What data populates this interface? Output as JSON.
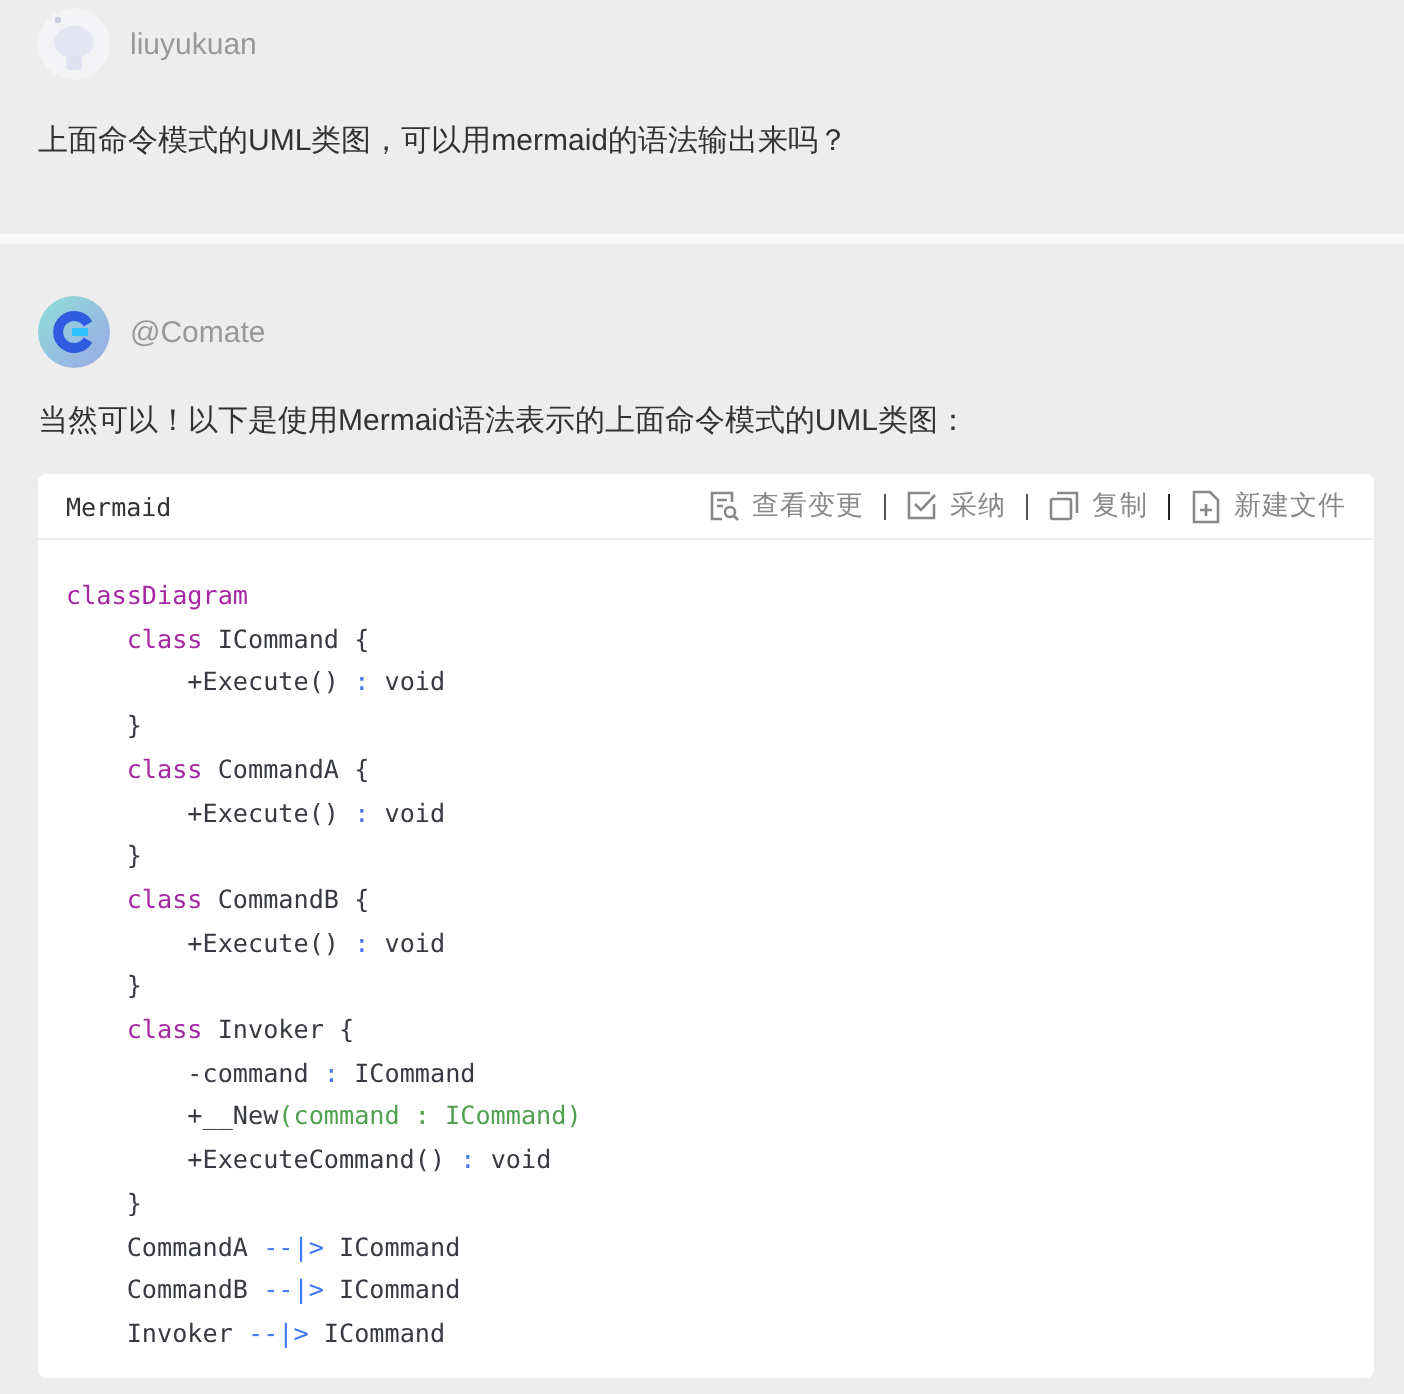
{
  "messages": [
    {
      "kind": "user",
      "author": "liuyukuan",
      "text": "上面命令模式的UML类图，可以用mermaid的语法输出来吗？"
    },
    {
      "kind": "bot",
      "author": "@Comate",
      "text": "当然可以！以下是使用Mermaid语法表示的上面命令模式的UML类图：",
      "code": {
        "language": "Mermaid",
        "actions": [
          {
            "kind": "diff",
            "label": "查看变更"
          },
          {
            "kind": "accept",
            "label": "采纳"
          },
          {
            "kind": "copy",
            "label": "复制"
          },
          {
            "kind": "newfile",
            "label": "新建文件"
          }
        ],
        "lines": [
          [
            {
              "kind": "keyword",
              "text": "classDiagram"
            }
          ],
          [
            {
              "kind": "keyword",
              "text": "    class"
            },
            {
              "kind": "plain",
              "text": " ICommand {"
            }
          ],
          [
            {
              "kind": "plain",
              "text": "        +Execute() "
            },
            {
              "kind": "operator",
              "text": ":"
            },
            {
              "kind": "plain",
              "text": " void"
            }
          ],
          [
            {
              "kind": "plain",
              "text": "    }"
            }
          ],
          [
            {
              "kind": "keyword",
              "text": "    class"
            },
            {
              "kind": "plain",
              "text": " CommandA {"
            }
          ],
          [
            {
              "kind": "plain",
              "text": "        +Execute() "
            },
            {
              "kind": "operator",
              "text": ":"
            },
            {
              "kind": "plain",
              "text": " void"
            }
          ],
          [
            {
              "kind": "plain",
              "text": "    }"
            }
          ],
          [
            {
              "kind": "keyword",
              "text": "    class"
            },
            {
              "kind": "plain",
              "text": " CommandB {"
            }
          ],
          [
            {
              "kind": "plain",
              "text": "        +Execute() "
            },
            {
              "kind": "operator",
              "text": ":"
            },
            {
              "kind": "plain",
              "text": " void"
            }
          ],
          [
            {
              "kind": "plain",
              "text": "    }"
            }
          ],
          [
            {
              "kind": "keyword",
              "text": "    class"
            },
            {
              "kind": "plain",
              "text": " Invoker {"
            }
          ],
          [
            {
              "kind": "plain",
              "text": "        -command "
            },
            {
              "kind": "operator",
              "text": ":"
            },
            {
              "kind": "plain",
              "text": " ICommand"
            }
          ],
          [
            {
              "kind": "plain",
              "text": "        +__New"
            },
            {
              "kind": "param",
              "text": "(command : ICommand)"
            }
          ],
          [
            {
              "kind": "plain",
              "text": "        +ExecuteCommand() "
            },
            {
              "kind": "operator",
              "text": ":"
            },
            {
              "kind": "plain",
              "text": " void"
            }
          ],
          [
            {
              "kind": "plain",
              "text": "    }"
            }
          ],
          [
            {
              "kind": "plain",
              "text": "    CommandA "
            },
            {
              "kind": "operator",
              "text": "--|>"
            },
            {
              "kind": "plain",
              "text": " ICommand"
            }
          ],
          [
            {
              "kind": "plain",
              "text": "    CommandB "
            },
            {
              "kind": "operator",
              "text": "--|>"
            },
            {
              "kind": "plain",
              "text": " ICommand"
            }
          ],
          [
            {
              "kind": "plain",
              "text": "    Invoker "
            },
            {
              "kind": "operator",
              "text": "--|>"
            },
            {
              "kind": "plain",
              "text": " ICommand"
            }
          ]
        ]
      }
    }
  ]
}
